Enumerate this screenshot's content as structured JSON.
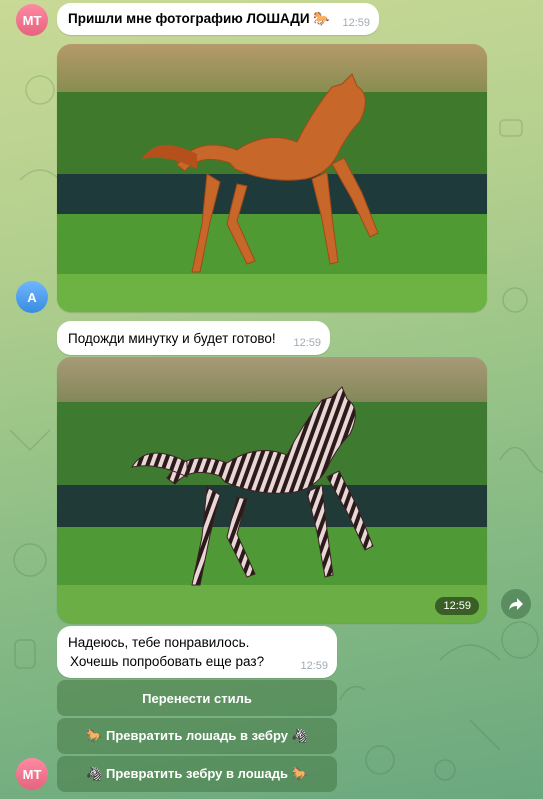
{
  "messages": {
    "m1": {
      "avatar": "MT",
      "text": "Пришли мне фотографию ЛОШАДИ 🐎",
      "time": "12:59"
    },
    "photo1": {
      "avatar": "A",
      "alt": "horse-photo"
    },
    "m2": {
      "text": "Подожди минутку и будет готово!",
      "time": "12:59"
    },
    "photo2": {
      "time": "12:59",
      "alt": "zebra-horse-photo"
    },
    "m3": {
      "line1": "Надеюсь, тебе понравилось.",
      "line2": "Хочешь попробовать еще раз?",
      "time": "12:59"
    }
  },
  "keyboard": {
    "b1": "Перенести стиль",
    "b2": "🐎 Превратить лошадь в зебру 🦓",
    "b3": "🦓 Превратить зебру в лошадь 🐎"
  },
  "footer_avatar": "MT",
  "icons": {
    "share": "share-arrow-icon"
  }
}
